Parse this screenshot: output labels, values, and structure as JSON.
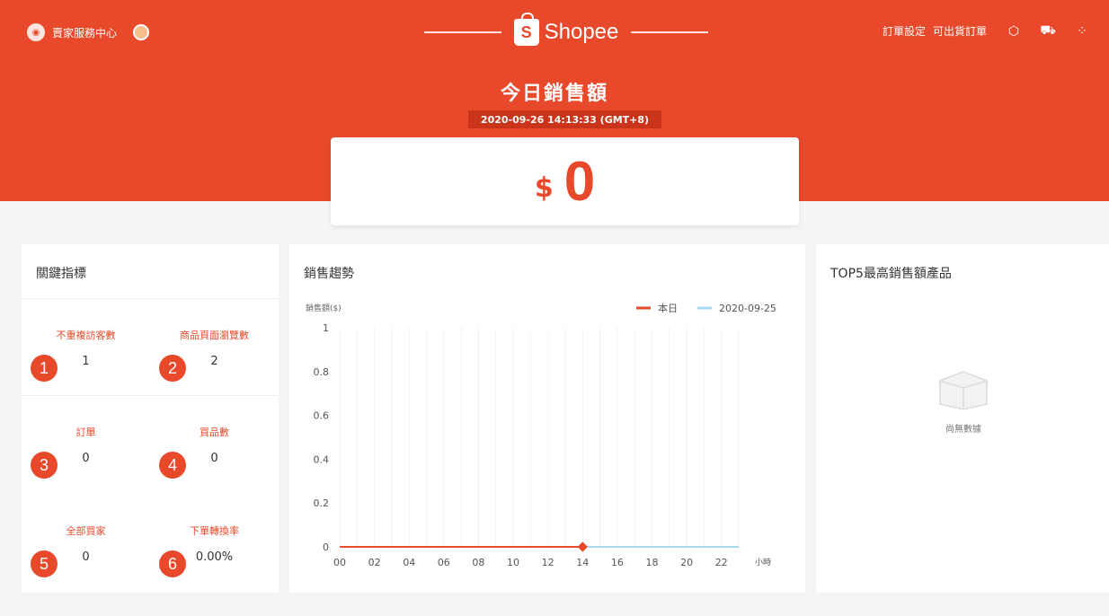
{
  "header": {
    "seller_center_label": "賣家服務中心",
    "brand_name": "Shopee",
    "links": [
      "訂單設定",
      "可出貨訂單"
    ],
    "title": "今日銷售額",
    "timestamp": "2020-09-26 14:13:33 (GMT+8)",
    "icons": [
      "settings-icon",
      "cart-icon",
      "grid-icon"
    ]
  },
  "sales": {
    "currency": "$",
    "value": "0"
  },
  "metrics_panel": {
    "title": "關鍵指標",
    "items": [
      {
        "badge": "1",
        "label": "不重複訪客數",
        "value": "1"
      },
      {
        "badge": "2",
        "label": "商品頁面瀏覽數",
        "value": "2"
      },
      {
        "badge": "3",
        "label": "訂單",
        "value": "0"
      },
      {
        "badge": "4",
        "label": "買品數",
        "value": "0"
      },
      {
        "badge": "5",
        "label": "全部買家",
        "value": "0"
      },
      {
        "badge": "6",
        "label": "下單轉換率",
        "value": "0.00%"
      }
    ]
  },
  "trend_panel": {
    "title": "銷售趨勢"
  },
  "top5_panel": {
    "title": "TOP5最高銷售額產品",
    "empty_text": "尚無數據"
  },
  "colors": {
    "accent": "#e8492a",
    "comparison_line": "#a9d8ef"
  },
  "chart_data": {
    "type": "line",
    "ylabel": "銷售額($)",
    "x_unit": "小時",
    "ylim": [
      0,
      1
    ],
    "y_ticks": [
      "0",
      "0.2",
      "0.4",
      "0.6",
      "0.8",
      "1"
    ],
    "x": [
      0,
      2,
      4,
      6,
      8,
      10,
      12,
      14,
      16,
      18,
      20,
      22
    ],
    "x_tick_labels": [
      "00",
      "02",
      "04",
      "06",
      "08",
      "10",
      "12",
      "14",
      "16",
      "18",
      "20",
      "22"
    ],
    "series": [
      {
        "name": "本日",
        "color": "#e8492a",
        "x": [
          0,
          14
        ],
        "y": [
          0,
          0
        ]
      },
      {
        "name": "2020-09-25",
        "color": "#a9d8ef",
        "x": [
          0,
          23
        ],
        "y": [
          0,
          0
        ]
      }
    ],
    "grid": true,
    "legend": "top-right"
  }
}
